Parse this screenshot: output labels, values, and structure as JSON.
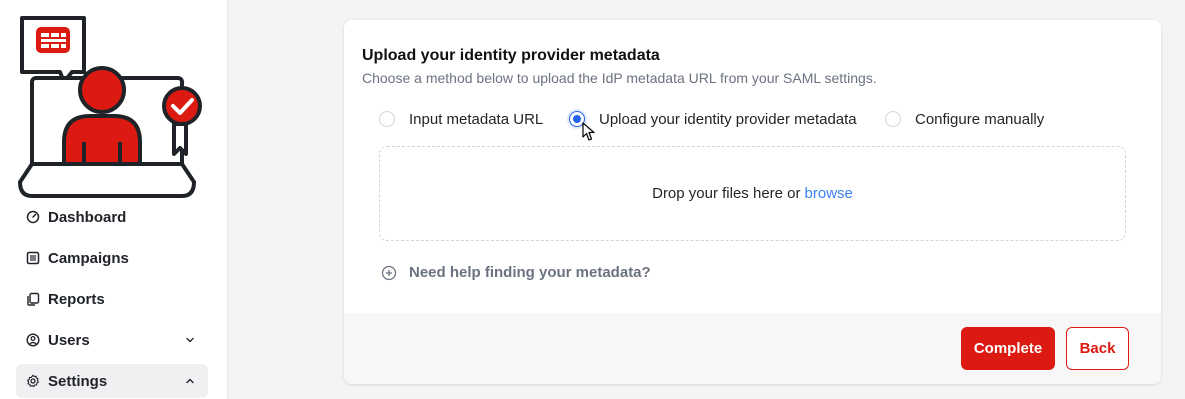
{
  "colors": {
    "brand_red": "#dc1a12",
    "accent_blue": "#2563eb",
    "link_blue": "#3b82f6"
  },
  "sidebar": {
    "logo_icon": "fortinet-user-certified-icon",
    "items": [
      {
        "label": "Dashboard",
        "icon": "dashboard-gauge-icon"
      },
      {
        "label": "Campaigns",
        "icon": "campaigns-icon"
      },
      {
        "label": "Reports",
        "icon": "reports-copy-icon"
      },
      {
        "label": "Users",
        "icon": "user-circle-icon",
        "expandable": true,
        "expanded": false
      },
      {
        "label": "Settings",
        "icon": "gear-icon",
        "expandable": true,
        "expanded": true,
        "active": true
      }
    ]
  },
  "main": {
    "title": "Upload your identity provider metadata",
    "subtitle": "Choose a method below to upload the IdP metadata URL from your SAML settings.",
    "options": [
      {
        "label": "Input metadata URL",
        "checked": false
      },
      {
        "label": "Upload your identity provider metadata",
        "checked": true
      },
      {
        "label": "Configure manually",
        "checked": false
      }
    ],
    "dropzone": {
      "text": "Drop your files here or",
      "link": "browse"
    },
    "help": {
      "label": "Need help finding your metadata?",
      "icon": "plus-circle-icon"
    },
    "buttons": {
      "complete": "Complete",
      "back": "Back"
    }
  }
}
